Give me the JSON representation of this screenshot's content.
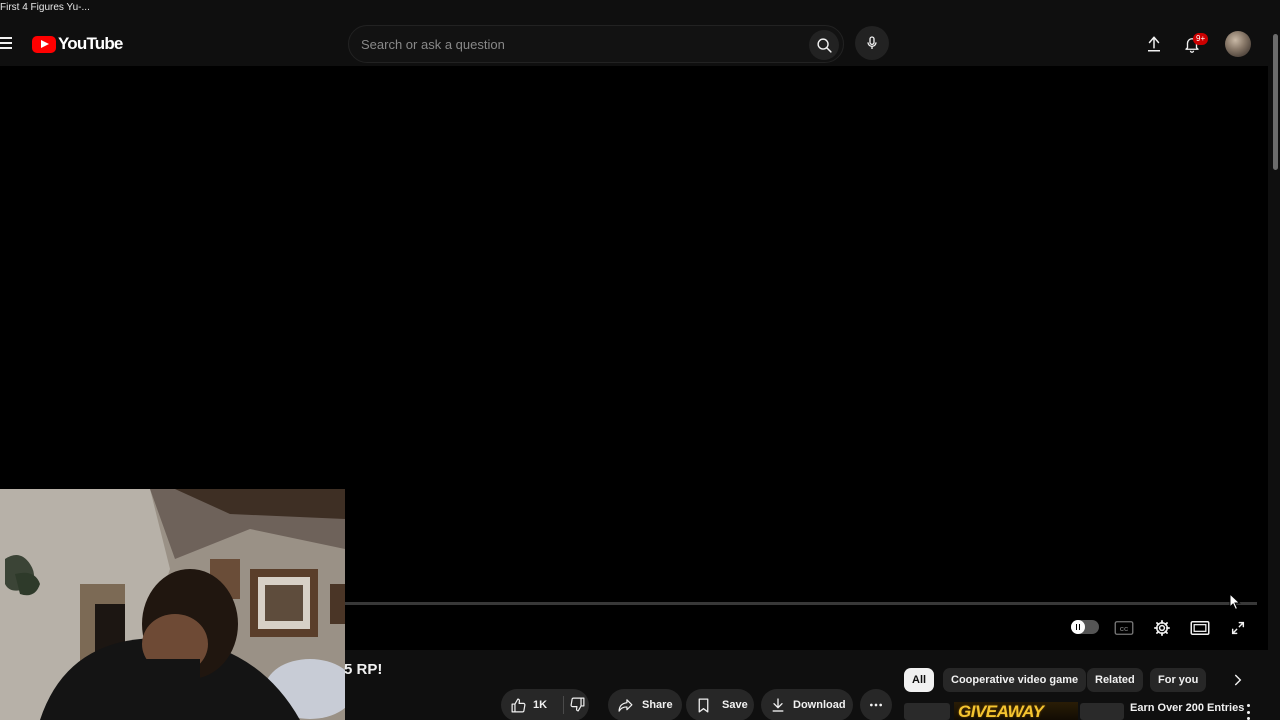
{
  "browser_tab": {
    "title": "First 4 Figures Yu-..."
  },
  "masthead": {
    "logo_text": "YouTube",
    "search": {
      "placeholder": "Search or ask a question",
      "value": ""
    },
    "notifications_badge": "9+",
    "icons": [
      "menu-icon",
      "search-icon",
      "mic-icon",
      "upload-icon",
      "bell-icon"
    ]
  },
  "player": {
    "progress": 0.0,
    "controls": [
      "autoplay-toggle",
      "captions-icon",
      "settings-icon",
      "theater-mode-icon",
      "fullscreen-icon"
    ]
  },
  "video": {
    "title_visible": "5 RP!"
  },
  "actions": {
    "like_count": "1K",
    "share_label": "Share",
    "save_label": "Save",
    "download_label": "Download"
  },
  "chips": {
    "items": [
      {
        "label": "All",
        "active": true
      },
      {
        "label": "Cooperative video game",
        "active": false
      },
      {
        "label": "Related",
        "active": false
      },
      {
        "label": "For you",
        "active": false
      }
    ]
  },
  "ad": {
    "banner_text": "GIVEAWAY",
    "title": "Earn Over 200 Entries"
  },
  "colors": {
    "brand_red": "#ff0000",
    "badge_red": "#cc0000",
    "background": "#0f0f0f",
    "chip_bg": "#272727"
  }
}
